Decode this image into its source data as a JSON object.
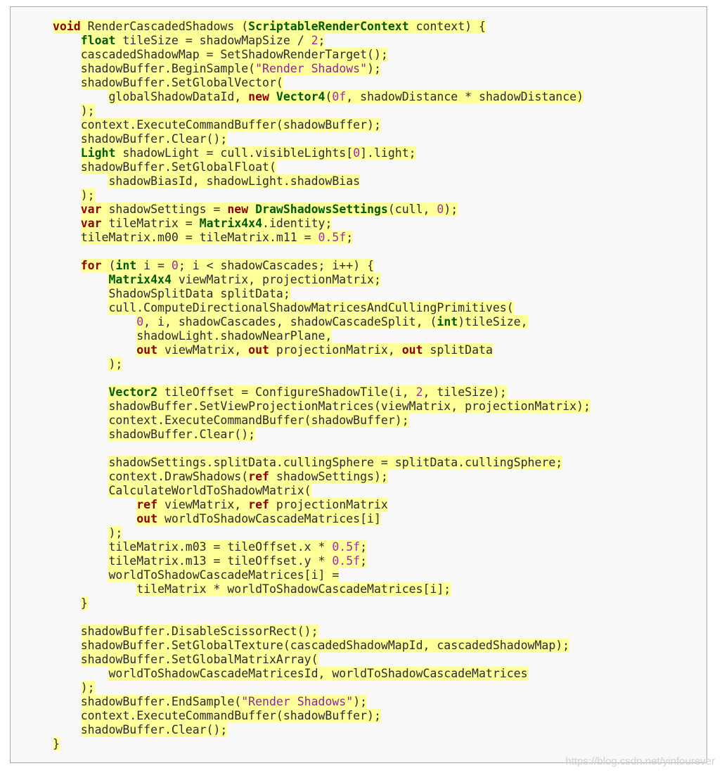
{
  "code": {
    "lines": [
      [
        {
          "t": "void",
          "c": "kw"
        },
        {
          "t": " RenderCascadedShadows ("
        },
        {
          "t": "ScriptableRenderContext",
          "c": "ty"
        },
        {
          "t": " context) {"
        }
      ],
      [
        {
          "t": "    "
        },
        {
          "t": "float",
          "c": "ty"
        },
        {
          "t": " tileSize = shadowMapSize / "
        },
        {
          "t": "2",
          "c": "num"
        },
        {
          "t": ";"
        }
      ],
      [
        {
          "t": "    cascadedShadowMap = SetShadowRenderTarget();"
        }
      ],
      [
        {
          "t": "    shadowBuffer.BeginSample("
        },
        {
          "t": "\"Render Shadows\"",
          "c": "str"
        },
        {
          "t": ");"
        }
      ],
      [
        {
          "t": "    shadowBuffer.SetGlobalVector("
        }
      ],
      [
        {
          "t": "        globalShadowDataId, "
        },
        {
          "t": "new",
          "c": "kw"
        },
        {
          "t": " "
        },
        {
          "t": "Vector4",
          "c": "ty"
        },
        {
          "t": "("
        },
        {
          "t": "0f",
          "c": "num"
        },
        {
          "t": ", shadowDistance * shadowDistance)"
        }
      ],
      [
        {
          "t": "    );"
        }
      ],
      [
        {
          "t": "    context.ExecuteCommandBuffer(shadowBuffer);"
        }
      ],
      [
        {
          "t": "    shadowBuffer.Clear();"
        }
      ],
      [
        {
          "t": "    "
        },
        {
          "t": "Light",
          "c": "ty"
        },
        {
          "t": " shadowLight = cull.visibleLights["
        },
        {
          "t": "0",
          "c": "num"
        },
        {
          "t": "].light;"
        }
      ],
      [
        {
          "t": "    shadowBuffer.SetGlobalFloat("
        }
      ],
      [
        {
          "t": "        shadowBiasId, shadowLight.shadowBias"
        }
      ],
      [
        {
          "t": "    );"
        }
      ],
      [
        {
          "t": "    "
        },
        {
          "t": "var",
          "c": "kw"
        },
        {
          "t": " shadowSettings = "
        },
        {
          "t": "new",
          "c": "kw"
        },
        {
          "t": " "
        },
        {
          "t": "DrawShadowsSettings",
          "c": "ty"
        },
        {
          "t": "(cull, "
        },
        {
          "t": "0",
          "c": "num"
        },
        {
          "t": ");"
        }
      ],
      [
        {
          "t": "    "
        },
        {
          "t": "var",
          "c": "kw"
        },
        {
          "t": " tileMatrix = "
        },
        {
          "t": "Matrix4x4",
          "c": "ty"
        },
        {
          "t": ".identity;"
        }
      ],
      [
        {
          "t": "    tileMatrix.m00 = tileMatrix.m11 = "
        },
        {
          "t": "0.5f",
          "c": "num"
        },
        {
          "t": ";"
        }
      ],
      [],
      [
        {
          "t": "    "
        },
        {
          "t": "for",
          "c": "kw"
        },
        {
          "t": " ("
        },
        {
          "t": "int",
          "c": "ty"
        },
        {
          "t": " i = "
        },
        {
          "t": "0",
          "c": "num"
        },
        {
          "t": "; i < shadowCascades; i++) {"
        }
      ],
      [
        {
          "t": "        "
        },
        {
          "t": "Matrix4x4",
          "c": "ty"
        },
        {
          "t": " viewMatrix, projectionMatrix;"
        }
      ],
      [
        {
          "t": "        ShadowSplitData splitData;"
        }
      ],
      [
        {
          "t": "        cull.ComputeDirectionalShadowMatricesAndCullingPrimitives("
        }
      ],
      [
        {
          "t": "            "
        },
        {
          "t": "0",
          "c": "num"
        },
        {
          "t": ", i, shadowCascades, shadowCascadeSplit, ("
        },
        {
          "t": "int",
          "c": "ty"
        },
        {
          "t": ")tileSize,"
        }
      ],
      [
        {
          "t": "            shadowLight.shadowNearPlane,"
        }
      ],
      [
        {
          "t": "            "
        },
        {
          "t": "out",
          "c": "kw"
        },
        {
          "t": " viewMatrix, "
        },
        {
          "t": "out",
          "c": "kw"
        },
        {
          "t": " projectionMatrix, "
        },
        {
          "t": "out",
          "c": "kw"
        },
        {
          "t": " splitData"
        }
      ],
      [
        {
          "t": "        );"
        }
      ],
      [],
      [
        {
          "t": "        "
        },
        {
          "t": "Vector2",
          "c": "ty"
        },
        {
          "t": " tileOffset = ConfigureShadowTile(i, "
        },
        {
          "t": "2",
          "c": "num"
        },
        {
          "t": ", tileSize);"
        }
      ],
      [
        {
          "t": "        shadowBuffer.SetViewProjectionMatrices(viewMatrix, projectionMatrix);"
        }
      ],
      [
        {
          "t": "        context.ExecuteCommandBuffer(shadowBuffer);"
        }
      ],
      [
        {
          "t": "        shadowBuffer.Clear();"
        }
      ],
      [],
      [
        {
          "t": "        shadowSettings.splitData.cullingSphere = splitData.cullingSphere;"
        }
      ],
      [
        {
          "t": "        context.DrawShadows("
        },
        {
          "t": "ref",
          "c": "kw"
        },
        {
          "t": " shadowSettings);"
        }
      ],
      [
        {
          "t": "        CalculateWorldToShadowMatrix("
        }
      ],
      [
        {
          "t": "            "
        },
        {
          "t": "ref",
          "c": "kw"
        },
        {
          "t": " viewMatrix, "
        },
        {
          "t": "ref",
          "c": "kw"
        },
        {
          "t": " projectionMatrix"
        }
      ],
      [
        {
          "t": "            "
        },
        {
          "t": "out",
          "c": "kw"
        },
        {
          "t": " worldToShadowCascadeMatrices[i]"
        }
      ],
      [
        {
          "t": "        );"
        }
      ],
      [
        {
          "t": "        tileMatrix.m03 = tileOffset.x * "
        },
        {
          "t": "0.5f",
          "c": "num"
        },
        {
          "t": ";"
        }
      ],
      [
        {
          "t": "        tileMatrix.m13 = tileOffset.y * "
        },
        {
          "t": "0.5f",
          "c": "num"
        },
        {
          "t": ";"
        }
      ],
      [
        {
          "t": "        worldToShadowCascadeMatrices[i] ="
        }
      ],
      [
        {
          "t": "            tileMatrix * worldToShadowCascadeMatrices[i];"
        }
      ],
      [
        {
          "t": "    }"
        }
      ],
      [],
      [
        {
          "t": "    shadowBuffer.DisableScissorRect();"
        }
      ],
      [
        {
          "t": "    shadowBuffer.SetGlobalTexture(cascadedShadowMapId, cascadedShadowMap);"
        }
      ],
      [
        {
          "t": "    shadowBuffer.SetGlobalMatrixArray("
        }
      ],
      [
        {
          "t": "        worldToShadowCascadeMatricesId, worldToShadowCascadeMatrices"
        }
      ],
      [
        {
          "t": "    );"
        }
      ],
      [
        {
          "t": "    shadowBuffer.EndSample("
        },
        {
          "t": "\"Render Shadows\"",
          "c": "str"
        },
        {
          "t": ");"
        }
      ],
      [
        {
          "t": "    context.ExecuteCommandBuffer(shadowBuffer);"
        }
      ],
      [
        {
          "t": "    shadowBuffer.Clear();"
        }
      ],
      [
        {
          "t": "}"
        }
      ]
    ]
  },
  "watermark": "https://blog.csdn.net/yinfourever",
  "colors": {
    "highlight": "#ffff9a",
    "keyword": "#8b0000",
    "type": "#005a00",
    "number": "#a02da0",
    "frame_border": "#a9a9a9"
  }
}
